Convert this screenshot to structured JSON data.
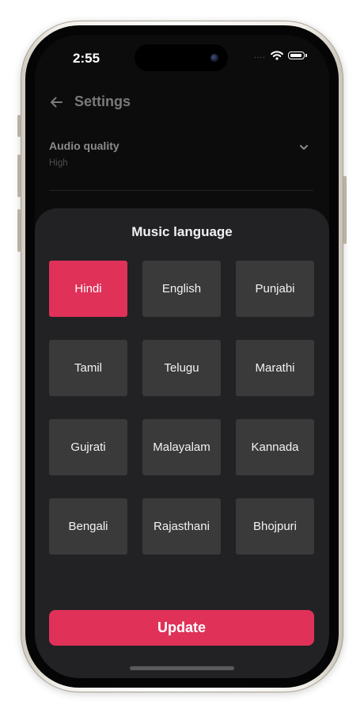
{
  "status_bar": {
    "time": "2:55",
    "dots": "...."
  },
  "header": {
    "title": "Settings"
  },
  "settings": {
    "audio_quality": {
      "label": "Audio quality",
      "value": "High"
    }
  },
  "sheet": {
    "title": "Music language",
    "languages": [
      {
        "label": "Hindi",
        "selected": true
      },
      {
        "label": "English",
        "selected": false
      },
      {
        "label": "Punjabi",
        "selected": false
      },
      {
        "label": "Tamil",
        "selected": false
      },
      {
        "label": "Telugu",
        "selected": false
      },
      {
        "label": "Marathi",
        "selected": false
      },
      {
        "label": "Gujrati",
        "selected": false
      },
      {
        "label": "Malayalam",
        "selected": false
      },
      {
        "label": "Kannada",
        "selected": false
      },
      {
        "label": "Bengali",
        "selected": false
      },
      {
        "label": "Rajasthani",
        "selected": false
      },
      {
        "label": "Bhojpuri",
        "selected": false
      }
    ],
    "update_label": "Update"
  },
  "colors": {
    "accent": "#e03159",
    "tile": "#3a3a3a",
    "sheet": "#222225",
    "background": "#0c0c0c"
  },
  "icons": {
    "back": "arrow-left-icon",
    "expand": "chevron-down-icon",
    "wifi": "wifi-icon",
    "battery": "battery-icon"
  }
}
